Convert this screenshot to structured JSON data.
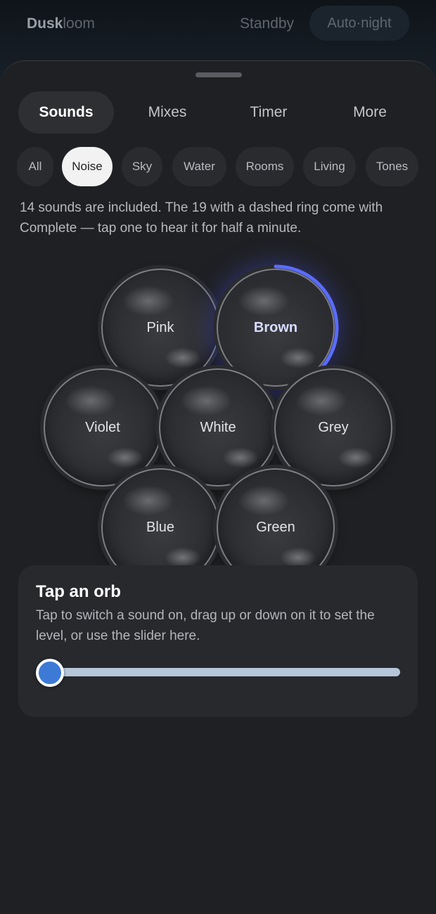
{
  "header": {
    "brand_part1": "Dusk",
    "brand_part2": "loom",
    "standby_label": "Standby",
    "auto_night_label": "Auto·night"
  },
  "tabs": [
    {
      "label": "Sounds",
      "active": true
    },
    {
      "label": "Mixes",
      "active": false
    },
    {
      "label": "Timer",
      "active": false
    },
    {
      "label": "More",
      "active": false
    }
  ],
  "filters": [
    {
      "label": "All",
      "active": false
    },
    {
      "label": "Noise",
      "active": true
    },
    {
      "label": "Sky",
      "active": false
    },
    {
      "label": "Water",
      "active": false
    },
    {
      "label": "Rooms",
      "active": false
    },
    {
      "label": "Living",
      "active": false
    },
    {
      "label": "Tones",
      "active": false
    }
  ],
  "info_text": "14 sounds are included. The 19 with a dashed ring come with Complete — tap one to hear it for half a minute.",
  "orbs": [
    {
      "label": "Pink",
      "active": false
    },
    {
      "label": "Brown",
      "active": true,
      "level": 0.4
    },
    {
      "label": "Violet",
      "active": false
    },
    {
      "label": "White",
      "active": false
    },
    {
      "label": "Grey",
      "active": false
    },
    {
      "label": "Blue",
      "active": false
    },
    {
      "label": "Green",
      "active": false
    }
  ],
  "panel": {
    "title": "Tap an orb",
    "description": "Tap to switch a sound on, drag up or down on it to set the level, or use the slider here.",
    "slider_value": 0
  },
  "colors": {
    "accent_ring": "#5a6cff",
    "slider_thumb": "#3d7ad6",
    "slider_track": "#b6c6db"
  }
}
